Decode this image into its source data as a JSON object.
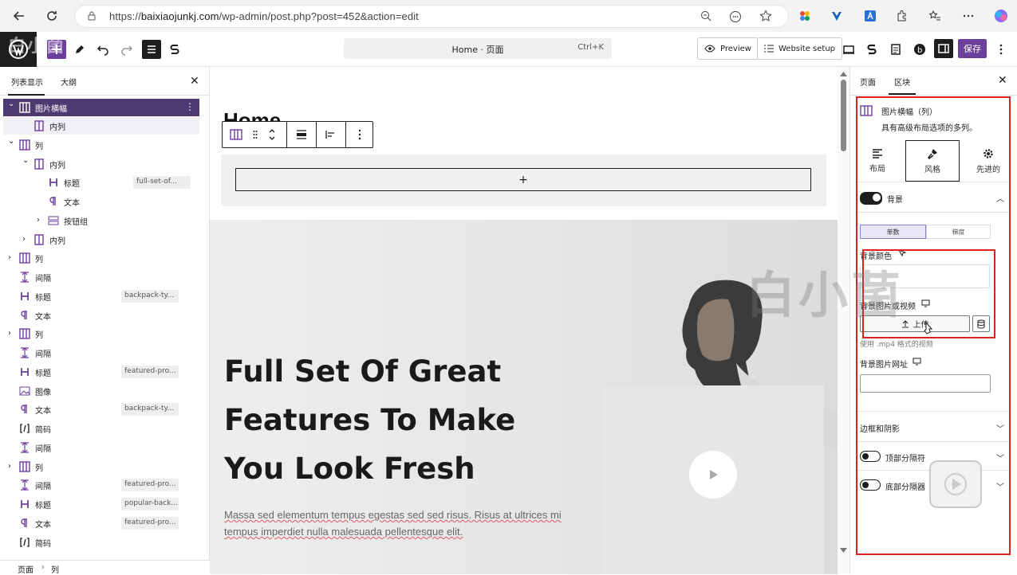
{
  "browser": {
    "url_prefix": "https://",
    "url_domain": "baixiaojunkj.com",
    "url_path": "/wp-admin/post.php?post=452&action=edit"
  },
  "toolbar": {
    "doc_title": "Home · 页面",
    "doc_shortcut": "Ctrl+K",
    "preview_label": "Preview",
    "website_setup_label": "Website setup",
    "save_label": "保存"
  },
  "left_panel": {
    "tab_list": "列表显示",
    "tab_outline": "大纲",
    "tree": [
      {
        "label": "图片横幅",
        "badge": "",
        "icon": "columns-icon"
      },
      {
        "label": "内列",
        "badge": "",
        "icon": "column-icon"
      },
      {
        "label": "列",
        "badge": "",
        "icon": "columns-icon"
      },
      {
        "label": "内列",
        "badge": "",
        "icon": "column-icon"
      },
      {
        "label": "标题",
        "badge": "full-set-of...",
        "icon": "heading-icon"
      },
      {
        "label": "文本",
        "badge": "",
        "icon": "paragraph-icon"
      },
      {
        "label": "按钮组",
        "badge": "",
        "icon": "buttons-icon"
      },
      {
        "label": "内列",
        "badge": "",
        "icon": "column-icon"
      },
      {
        "label": "列",
        "badge": "",
        "icon": "columns-icon"
      },
      {
        "label": "间隔",
        "badge": "",
        "icon": "spacer-icon"
      },
      {
        "label": "标题",
        "badge": "backpack-ty...",
        "icon": "heading-icon"
      },
      {
        "label": "文本",
        "badge": "",
        "icon": "paragraph-icon"
      },
      {
        "label": "列",
        "badge": "",
        "icon": "columns-icon"
      },
      {
        "label": "间隔",
        "badge": "",
        "icon": "spacer-icon"
      },
      {
        "label": "标题",
        "badge": "featured-pro...",
        "icon": "heading-icon"
      },
      {
        "label": "图像",
        "badge": "",
        "icon": "image-icon"
      },
      {
        "label": "文本",
        "badge": "backpack-ty...",
        "icon": "paragraph-icon"
      },
      {
        "label": "简码",
        "badge": "",
        "icon": "shortcode-icon"
      },
      {
        "label": "间隔",
        "badge": "",
        "icon": "spacer-icon"
      },
      {
        "label": "列",
        "badge": "",
        "icon": "columns-icon"
      },
      {
        "label": "间隔",
        "badge": "featured-pro...",
        "icon": "spacer-icon"
      },
      {
        "label": "标题",
        "badge": "popular-back...",
        "icon": "heading-icon"
      },
      {
        "label": "文本",
        "badge": "featured-pro...",
        "icon": "paragraph-icon"
      },
      {
        "label": "简码",
        "badge": "",
        "icon": "shortcode-icon"
      }
    ],
    "breadcrumb_root": "页面",
    "breadcrumb_current": "列"
  },
  "canvas": {
    "page_heading": "Home",
    "hero_title": "Full Set Of Great Features To Make You Look Fresh",
    "hero_text": "Massa sed elementum tempus egestas sed sed risus. Risus at ultrices mi tempus imperdiet nulla malesuada pellentesque elit."
  },
  "right_panel": {
    "tab_page": "页面",
    "tab_block": "区块",
    "block_title": "图片横幅（列）",
    "block_desc": "具有高级布局选项的多列。",
    "subtab_layout": "布局",
    "subtab_style": "风格",
    "subtab_advanced": "先进的",
    "background_label": "背景",
    "seg_single": "单数",
    "seg_gradient": "梯度",
    "bg_color_label": "背景颜色",
    "bg_image_label": "背景图片或视频",
    "upload_label": "上传",
    "mp4_hint": "使用 .mp4 格式的视频",
    "bg_image_url_label": "背景图片网址",
    "border_shadow_label": "边框和阴影",
    "top_divider_label": "顶部分隔符",
    "bottom_divider_label": "底部分隔器"
  },
  "watermark": {
    "text": "白小菌"
  },
  "colors": {
    "accent": "#6b3f9c",
    "selected_row": "#4e3a70",
    "highlight_frame": "#e02020"
  }
}
